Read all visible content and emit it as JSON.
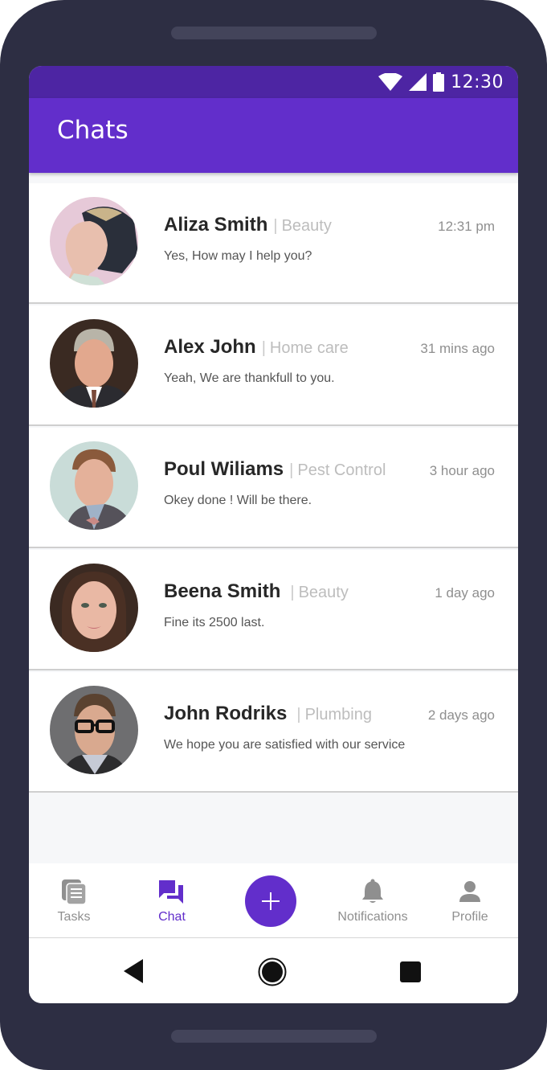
{
  "status_bar": {
    "time": "12:30",
    "icons": [
      "wifi-icon",
      "cellular-signal-icon",
      "battery-icon"
    ]
  },
  "app_bar": {
    "title": "Chats"
  },
  "chats": [
    {
      "name": "Aliza Smith",
      "category": "Beauty",
      "time": "12:31 pm",
      "message": "Yes, How may I help you?",
      "avatar": "woman-profile-photo"
    },
    {
      "name": "Alex John",
      "category": "Home care",
      "time": "31 mins ago",
      "message": "Yeah, We are thankfull to you.",
      "avatar": "man-suit-photo"
    },
    {
      "name": "Poul Wiliams",
      "category": "Pest Control",
      "time": "3 hour ago",
      "message": "Okey done ! Will be there.",
      "avatar": "man-bowtie-photo"
    },
    {
      "name": "Beena Smith",
      "category": "Beauty",
      "time": "1 day ago",
      "message": "Fine its 2500 last.",
      "avatar": "woman-portrait-photo"
    },
    {
      "name": "John Rodriks",
      "category": "Plumbing",
      "time": "2 days ago",
      "message": "We hope you are satisfied with our service",
      "avatar": "man-glasses-photo"
    }
  ],
  "separator": "|",
  "bottom_nav": {
    "items": [
      {
        "label": "Tasks",
        "icon": "tasks-icon",
        "active": false
      },
      {
        "label": "Chat",
        "icon": "chat-icon",
        "active": true
      },
      {
        "label": "Notifications",
        "icon": "bell-icon",
        "active": false
      },
      {
        "label": "Profile",
        "icon": "person-icon",
        "active": false
      }
    ],
    "fab": {
      "icon": "plus-icon",
      "action": "add"
    }
  },
  "system_nav": {
    "buttons": [
      "back",
      "home",
      "recents"
    ]
  },
  "colors": {
    "primary": "#622ecb",
    "primary_dark": "#4d25a3",
    "frame": "#2d2e43",
    "inactive": "#8f8f8f"
  }
}
